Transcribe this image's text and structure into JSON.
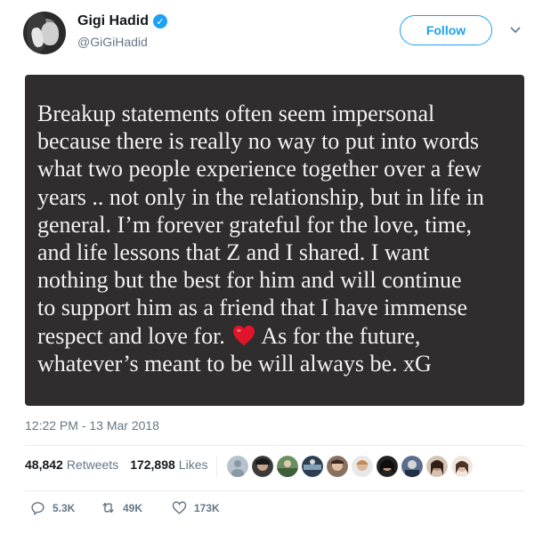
{
  "user": {
    "name": "Gigi Hadid",
    "handle": "@GiGiHadid",
    "verified": true
  },
  "follow_label": "Follow",
  "statement_lines": [
    "Breakup statements often seem impersonal",
    "because there is really no way to put into words",
    "what two people experience together over a few",
    "years .. not only in the relationship, but in life in",
    "general. I’m forever grateful for the love, time,",
    "and life lessons that Z and I shared. I want",
    "nothing but the best for him and will continue",
    "to support him as a friend that I have immense"
  ],
  "statement_line9_a": "respect and love for.",
  "statement_line9_b": "As for the future,",
  "statement_line10": "whatever’s meant to be will always be. xG",
  "timestamp": "12:22 PM - 13 Mar 2018",
  "stats": {
    "retweets_count": "48,842",
    "retweets_label": "Retweets",
    "likes_count": "172,898",
    "likes_label": "Likes"
  },
  "actions": {
    "reply_count": "5.3K",
    "retweet_count": "49K",
    "like_count": "173K"
  },
  "colors": {
    "accent": "#1da1f2",
    "muted": "#657786",
    "media_bg": "#2f2d2e",
    "heart": "#e0142a"
  }
}
